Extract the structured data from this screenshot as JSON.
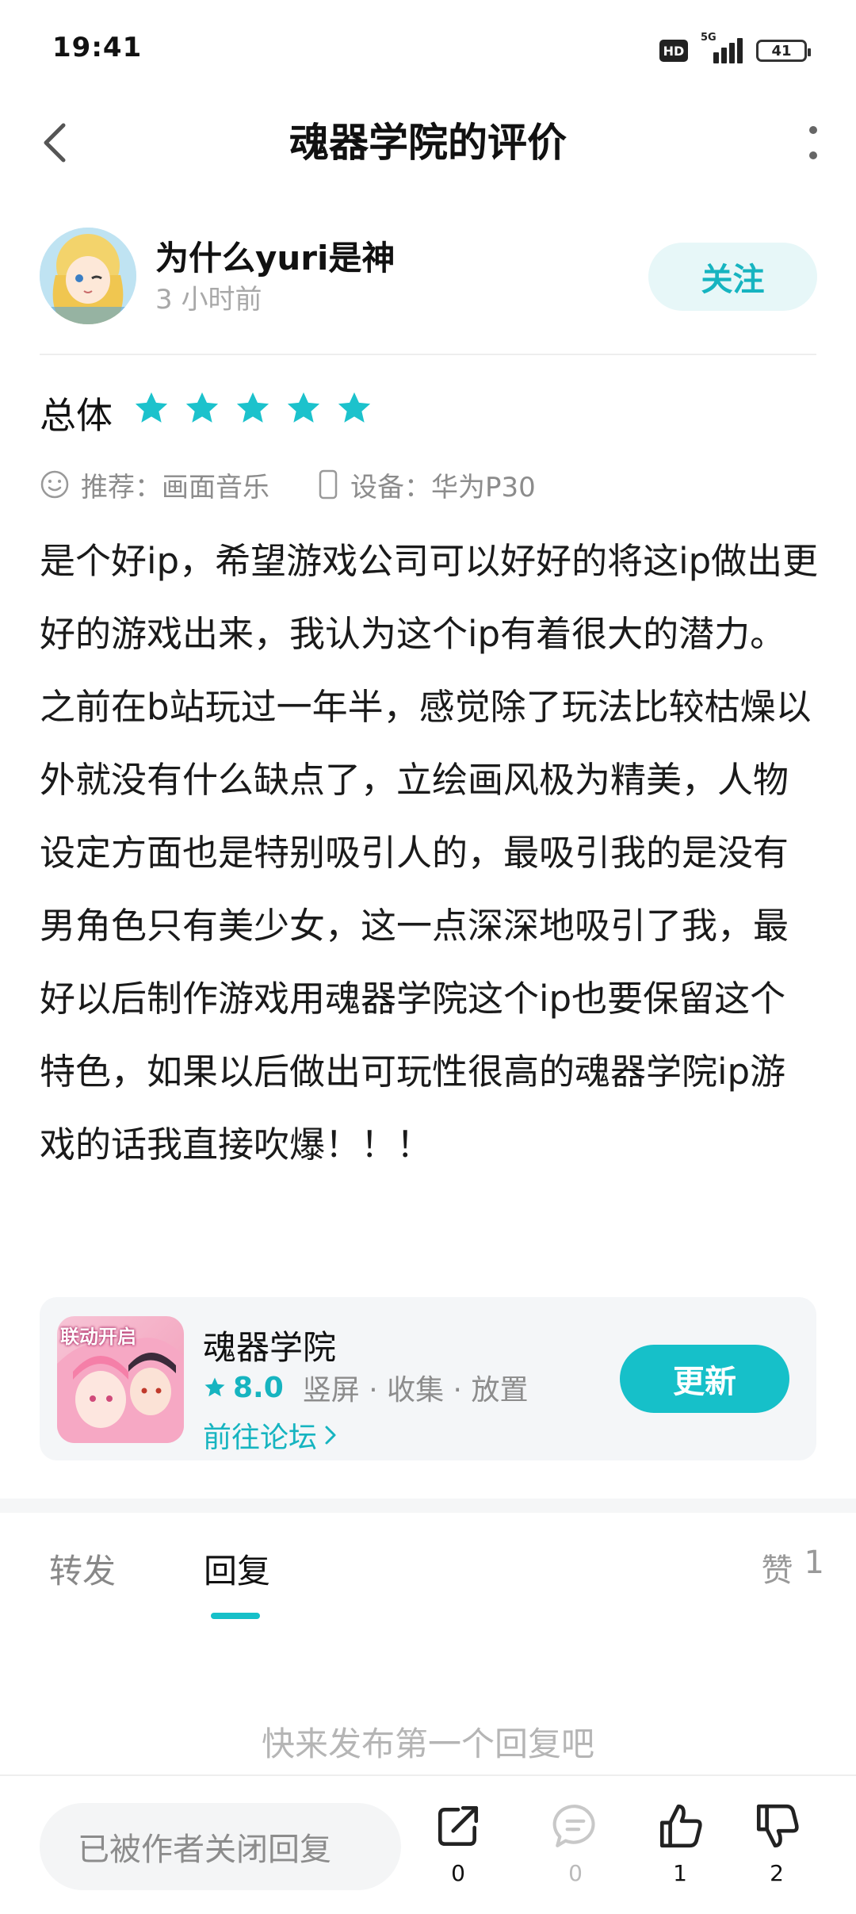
{
  "status_bar": {
    "time": "19:41",
    "hd": "HD",
    "network": "5G",
    "battery": "41"
  },
  "header": {
    "title": "魂器学院的评价"
  },
  "author": {
    "name": "为什么yuri是神",
    "time": "3 小时前",
    "follow_label": "关注"
  },
  "rating": {
    "label": "总体",
    "stars": 5,
    "star_color": "#1cc2cc"
  },
  "meta": {
    "recommend": "推荐：画面音乐",
    "device": "设备：华为P30"
  },
  "review": {
    "text": "是个好ip，希望游戏公司可以好好的将这ip做出更好的游戏出来，我认为这个ip有着很大的潜力。之前在b站玩过一年半，感觉除了玩法比较枯燥以外就没有什么缺点了，立绘画风极为精美，人物设定方面也是特别吸引人的，最吸引我的是没有男角色只有美少女，这一点深深地吸引了我，最好以后制作游戏用魂器学院这个ip也要保留这个特色，如果以后做出可玩性很高的魂器学院ip游戏的话我直接吹爆！！！"
  },
  "game_card": {
    "icon_text": "联动开启",
    "name": "魂器学院",
    "score": "8.0",
    "tags": "竖屏 · 收集 · 放置",
    "forum_link": "前往论坛",
    "update_label": "更新"
  },
  "tabs": {
    "share": "转发",
    "reply": "回复",
    "likes_label": "赞",
    "likes_count": "1"
  },
  "empty_hint": "快来发布第一个回复吧",
  "bottom_bar": {
    "reply_placeholder": "已被作者关闭回复",
    "share_count": "0",
    "comment_count": "0",
    "like_count": "1",
    "dislike_count": "2"
  },
  "colors": {
    "accent": "#16c0c9",
    "accent_text": "#16b4c0"
  }
}
